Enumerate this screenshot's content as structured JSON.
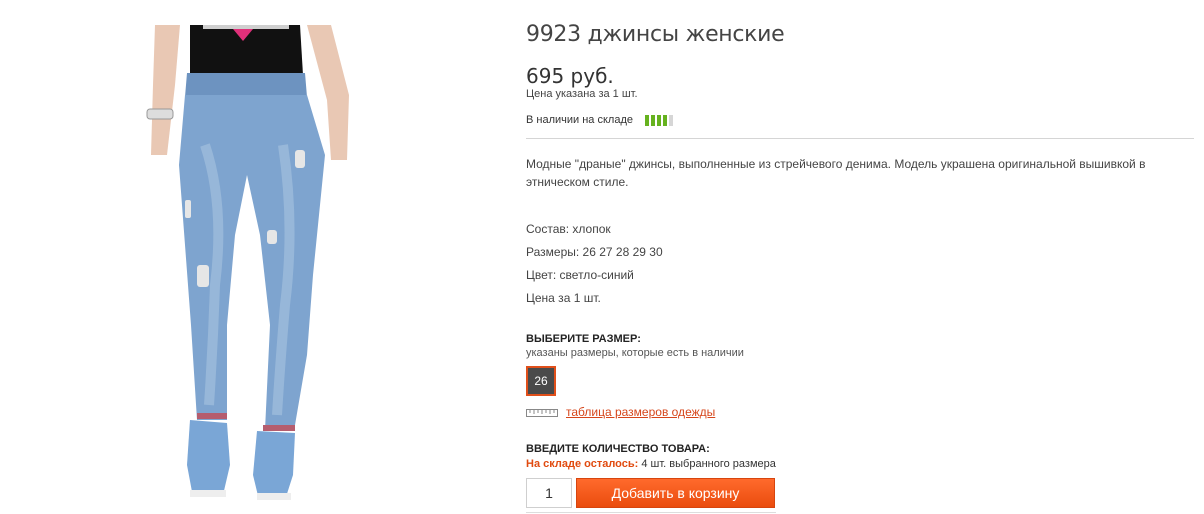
{
  "product": {
    "title": "9923 джинсы женские",
    "price": "695 руб.",
    "price_note": "Цена указана за 1 шт.",
    "stock_label": "В наличии на складе",
    "stock_level": 0.8,
    "description": "Модные \"драные\" джинсы, выполненные из стрейчевого денима. Модель украшена оригинальной вышивкой в этническом стиле.",
    "specs": [
      "Состав: хлопок",
      "Размеры: 26 27 28 29 30",
      "Цвет: светло-синий",
      "Цена за 1 шт."
    ]
  },
  "size_selector": {
    "title": "ВЫБЕРИТЕ РАЗМЕР:",
    "subtitle": "указаны размеры, которые есть в наличии",
    "sizes": [
      "26"
    ],
    "size_table_link": "таблица размеров одежды"
  },
  "quantity": {
    "title": "ВВЕДИТЕ КОЛИЧЕСТВО ТОВАРА:",
    "stock_left_label": "На складе осталось:",
    "stock_left_value": "4 шт. выбранного размера",
    "value": "1",
    "add_button": "Добавить в корзину"
  },
  "colors": {
    "accent": "#ea4c0e",
    "stock_green": "#66b21f",
    "denim": "#7ea4cf"
  },
  "icons": {
    "ruler": "ruler-icon"
  }
}
